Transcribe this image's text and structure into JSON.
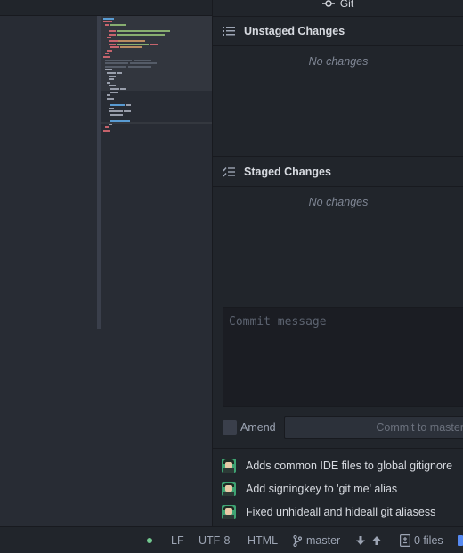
{
  "git_panel": {
    "title": "Git",
    "unstaged": {
      "title": "Unstaged Changes",
      "empty_text": "No changes"
    },
    "staged": {
      "title": "Staged Changes",
      "empty_text": "No changes"
    },
    "commit_message_placeholder": "Commit message",
    "amend_label": "Amend",
    "commit_button_label": "Commit to master",
    "recent_commits": [
      {
        "message": "Adds common IDE files to global gitignore"
      },
      {
        "message": "Add signingkey to 'git me' alias"
      },
      {
        "message": "Fixed unhideall and hideall git aliasess"
      }
    ]
  },
  "status_bar": {
    "line_ending": "LF",
    "encoding": "UTF-8",
    "grammar": "HTML",
    "branch": "master",
    "files_label": "0 files"
  },
  "colors": {
    "status_ok": "#73c990",
    "avatar_bg": "#3fa373"
  }
}
